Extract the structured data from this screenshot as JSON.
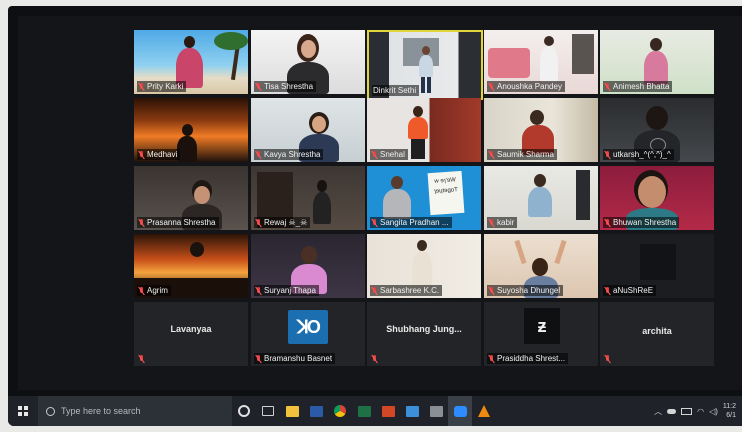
{
  "gallery": {
    "participants": [
      {
        "name": "Prity Karki",
        "muted": true
      },
      {
        "name": "Tisa Shrestha",
        "muted": true
      },
      {
        "name": "Dinkrit Sethi",
        "muted": false,
        "active_speaker": true
      },
      {
        "name": "Anoushka Pandey",
        "muted": true
      },
      {
        "name": "Animesh Bhatta",
        "muted": true
      },
      {
        "name": "Medhavi",
        "muted": true
      },
      {
        "name": "Kavya Shrestha",
        "muted": true
      },
      {
        "name": "Snehal",
        "muted": true
      },
      {
        "name": "Saumik Sharma",
        "muted": true
      },
      {
        "name": "utkarsh_^(^,^)_^",
        "muted": true
      },
      {
        "name": "Prasanna Shrestha",
        "muted": true
      },
      {
        "name": "Rewaj ☠_☠",
        "muted": true
      },
      {
        "name": "Sangita Pradhan ...",
        "muted": true
      },
      {
        "name": "kabir",
        "muted": true
      },
      {
        "name": "Bhuwan Shrestha",
        "muted": true
      },
      {
        "name": "Agrim",
        "muted": true
      },
      {
        "name": "Suryanj Thapa",
        "muted": true
      },
      {
        "name": "Sarbashree K.C.",
        "muted": true
      },
      {
        "name": "Suyosha Dhungel",
        "muted": true
      },
      {
        "name": "aNuShReE",
        "muted": true
      },
      {
        "name": "Lavanyaa",
        "muted": true,
        "video_off": true
      },
      {
        "name": "Bramanshu Basnet",
        "muted": true
      },
      {
        "name": "Shubhang  Jung...",
        "muted": true,
        "video_off": true
      },
      {
        "name": "Prasiddha Shrest...",
        "muted": true
      },
      {
        "name": "archita",
        "muted": true,
        "video_off": true
      }
    ],
    "whiteboard_text": [
      "w ɘɿ'ɘW",
      "ɿɘɥtɘgoT"
    ]
  },
  "taskbar": {
    "search_placeholder": "Type here to search",
    "clock_time": "11:2",
    "clock_date": "6/1",
    "colors": {
      "taskbar_bg": "#1f2329",
      "active_speaker_border": "#e0d63b",
      "mute_red": "#e34040"
    },
    "pinned_icons": [
      "task-view-icon",
      "file-explorer-icon",
      "word-icon",
      "chrome-icon",
      "excel-icon",
      "powerpoint-icon",
      "photos-icon",
      "camera-icon",
      "zoom-icon",
      "vlc-icon"
    ]
  }
}
